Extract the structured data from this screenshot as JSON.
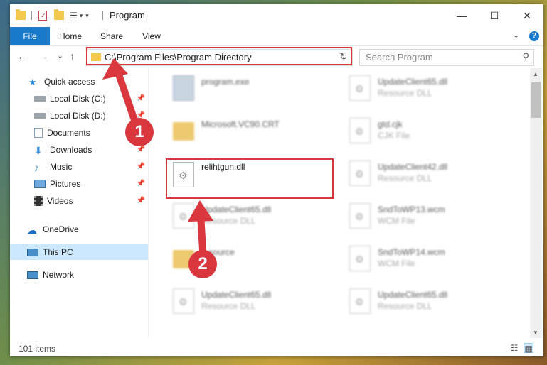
{
  "window": {
    "title": "Program",
    "minimize_glyph": "—",
    "maximize_glyph": "☐",
    "close_glyph": "✕"
  },
  "ribbon": {
    "tabs": [
      "File",
      "Home",
      "Share",
      "View"
    ],
    "expand_glyph": "⌄",
    "help_glyph": "?"
  },
  "nav": {
    "back_glyph": "←",
    "forward_glyph": "→",
    "recent_glyph": "⌄",
    "up_glyph": "↑",
    "address": "C:\\Program Files\\Program Directory",
    "address_chevron": "⌄",
    "refresh_glyph": "↻",
    "search_placeholder": "Search Program",
    "search_glyph": "⚲"
  },
  "sidebar": {
    "items": [
      {
        "label": "Quick access",
        "icon": "star-icon",
        "pinned": false
      },
      {
        "label": "Local Disk (C:)",
        "icon": "drive-icon",
        "pinned": true
      },
      {
        "label": "Local Disk (D:)",
        "icon": "drive-icon",
        "pinned": true
      },
      {
        "label": "Documents",
        "icon": "documents-icon",
        "pinned": true
      },
      {
        "label": "Downloads",
        "icon": "download-icon",
        "pinned": true
      },
      {
        "label": "Music",
        "icon": "music-icon",
        "pinned": true
      },
      {
        "label": "Pictures",
        "icon": "pictures-icon",
        "pinned": true
      },
      {
        "label": "Videos",
        "icon": "videos-icon",
        "pinned": true
      },
      {
        "label": "OneDrive",
        "icon": "cloud-icon",
        "pinned": false
      },
      {
        "label": "This PC",
        "icon": "computer-icon",
        "pinned": false,
        "selected": true
      },
      {
        "label": "Network",
        "icon": "network-icon",
        "pinned": false
      }
    ],
    "pin_glyph": "📌"
  },
  "files": [
    {
      "name": "program.exe",
      "type": "",
      "icon": "exe-icon",
      "blurred": true
    },
    {
      "name": "UpdateClient65.dll",
      "type": "Resource DLL",
      "icon": "dll-icon",
      "blurred": true
    },
    {
      "name": "Microsoft.VC90.CRT",
      "type": "",
      "icon": "folder-icon",
      "blurred": true
    },
    {
      "name": "gtd.cjk",
      "type": "CJK File",
      "icon": "file-icon",
      "blurred": true
    },
    {
      "name": "relihtgun.dll",
      "type": "",
      "icon": "dll-icon",
      "blurred": false
    },
    {
      "name": "UpdateClient42.dll",
      "type": "Resource DLL",
      "icon": "dll-icon",
      "blurred": true
    },
    {
      "name": "UpdateClient65.dll",
      "type": "Resource DLL",
      "icon": "dll-icon",
      "blurred": true
    },
    {
      "name": "SndToWP13.wcm",
      "type": "WCM File",
      "icon": "file-icon",
      "blurred": true
    },
    {
      "name": "resource",
      "type": "",
      "icon": "folder-icon",
      "blurred": true
    },
    {
      "name": "SndToWP14.wcm",
      "type": "WCM File",
      "icon": "file-icon",
      "blurred": true
    },
    {
      "name": "UpdateClient65.dll",
      "type": "Resource DLL",
      "icon": "dll-icon",
      "blurred": true
    },
    {
      "name": "UpdateClient65.dll",
      "type": "Resource DLL",
      "icon": "dll-icon",
      "blurred": true
    }
  ],
  "status": {
    "count": "101 items"
  },
  "annotations": {
    "marker1": "1",
    "marker2": "2",
    "color": "#d9363e"
  }
}
